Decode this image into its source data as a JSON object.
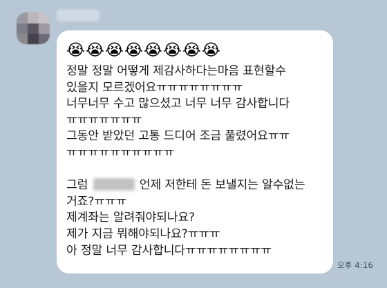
{
  "chat": {
    "avatar_icon": "sender-avatar",
    "name_redacted": true,
    "emojis": [
      "😭",
      "😭",
      "😭",
      "😭",
      "😭",
      "😭",
      "😭",
      "😭"
    ],
    "lines": [
      "정말 정말 어떻게 제감사하다는마음 표현할수",
      "있을지 모르겠어요ㅠㅠㅠㅠㅠㅠㅠㅠ",
      "너무너무 수고 많으셨고 너무 너무 감사합니다",
      "ㅠㅠㅠㅠㅠㅠㅠ",
      "그동안 받았던 고통 드디어 조금 풀렸어요ㅠㅠ",
      "ㅠㅠㅠㅠㅠㅠㅠㅠㅠㅠ",
      "",
      "",
      "거죠?ㅠㅠㅠ",
      "제계좌는 알려줘야되나요?",
      "제가 지금 뭐해야되나요?ㅠㅠㅠ",
      "아 정말 너무 감사합니다ㅠㅠㅠㅠㅠㅠㅠㅠ"
    ],
    "line8_before": "그럼",
    "line8_after": "언제 저한테 돈 보낼지는 알수없는",
    "timestamp": "오후 4:16"
  }
}
